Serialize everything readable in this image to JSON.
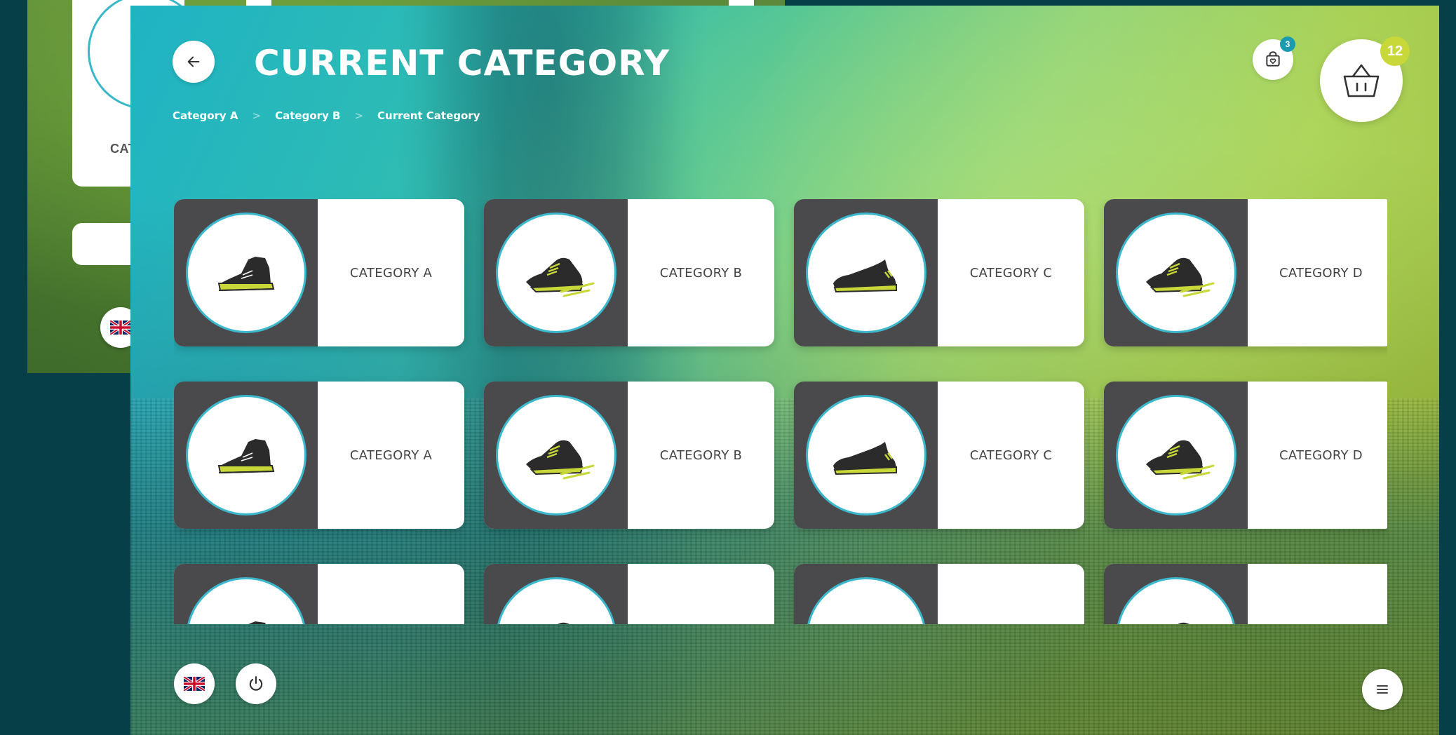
{
  "header": {
    "title": "CURRENT CATEGORY",
    "breadcrumb": [
      "Category A",
      "Category B",
      "Current Category"
    ]
  },
  "wishlist": {
    "count": "3"
  },
  "basket": {
    "count": "12"
  },
  "background_window": {
    "partial_label": "CAT"
  },
  "categories": [
    {
      "label": "CATEGORY A",
      "icon": "high-top-sneaker-icon"
    },
    {
      "label": "CATEGORY B",
      "icon": "running-shoe-icon"
    },
    {
      "label": "CATEGORY C",
      "icon": "sport-sneaker-icon"
    },
    {
      "label": "CATEGORY D",
      "icon": "running-shoe-icon"
    },
    {
      "label": "CATEGORY A",
      "icon": "high-top-sneaker-icon"
    },
    {
      "label": "CATEGORY B",
      "icon": "running-shoe-icon"
    },
    {
      "label": "CATEGORY C",
      "icon": "sport-sneaker-icon"
    },
    {
      "label": "CATEGORY D",
      "icon": "running-shoe-icon"
    },
    {
      "label": "",
      "icon": "high-top-sneaker-icon"
    },
    {
      "label": "",
      "icon": "running-shoe-icon"
    },
    {
      "label": "",
      "icon": "sport-sneaker-icon"
    },
    {
      "label": "",
      "icon": "running-shoe-icon"
    }
  ],
  "colors": {
    "accent_teal": "#3bb8cc",
    "badge_lime": "#c8d838",
    "badge_teal": "#1a9bb0",
    "tile_dark": "#4a4a4d"
  },
  "footer_icons": [
    "uk-flag-icon",
    "power-icon",
    "hamburger-menu-icon"
  ]
}
